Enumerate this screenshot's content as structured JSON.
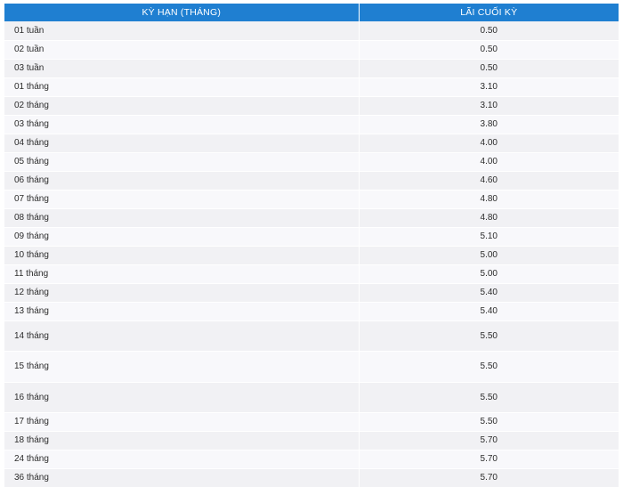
{
  "table": {
    "headers": {
      "term": "KỲ HẠN (THÁNG)",
      "rate": "LÃI CUỐI KỲ"
    },
    "rows": [
      {
        "term": "01 tuần",
        "rate": "0.50"
      },
      {
        "term": "02 tuần",
        "rate": "0.50"
      },
      {
        "term": "03 tuần",
        "rate": "0.50"
      },
      {
        "term": "01 tháng",
        "rate": "3.10"
      },
      {
        "term": "02 tháng",
        "rate": "3.10"
      },
      {
        "term": "03 tháng",
        "rate": "3.80"
      },
      {
        "term": "04 tháng",
        "rate": "4.00"
      },
      {
        "term": "05 tháng",
        "rate": "4.00"
      },
      {
        "term": "06 tháng",
        "rate": "4.60"
      },
      {
        "term": "07 tháng",
        "rate": "4.80"
      },
      {
        "term": "08 tháng",
        "rate": "4.80"
      },
      {
        "term": "09 tháng",
        "rate": "5.10"
      },
      {
        "term": "10 tháng",
        "rate": "5.00"
      },
      {
        "term": "11 tháng",
        "rate": "5.00"
      },
      {
        "term": "12 tháng",
        "rate": "5.40"
      },
      {
        "term": "13 tháng",
        "rate": "5.40"
      },
      {
        "term": "14 tháng",
        "rate": "5.50"
      },
      {
        "term": "15 tháng",
        "rate": "5.50"
      },
      {
        "term": "16 tháng",
        "rate": "5.50"
      },
      {
        "term": "17 tháng",
        "rate": "5.50"
      },
      {
        "term": "18 tháng",
        "rate": "5.70"
      },
      {
        "term": "24 tháng",
        "rate": "5.70"
      },
      {
        "term": "36 tháng",
        "rate": "5.70"
      }
    ]
  }
}
